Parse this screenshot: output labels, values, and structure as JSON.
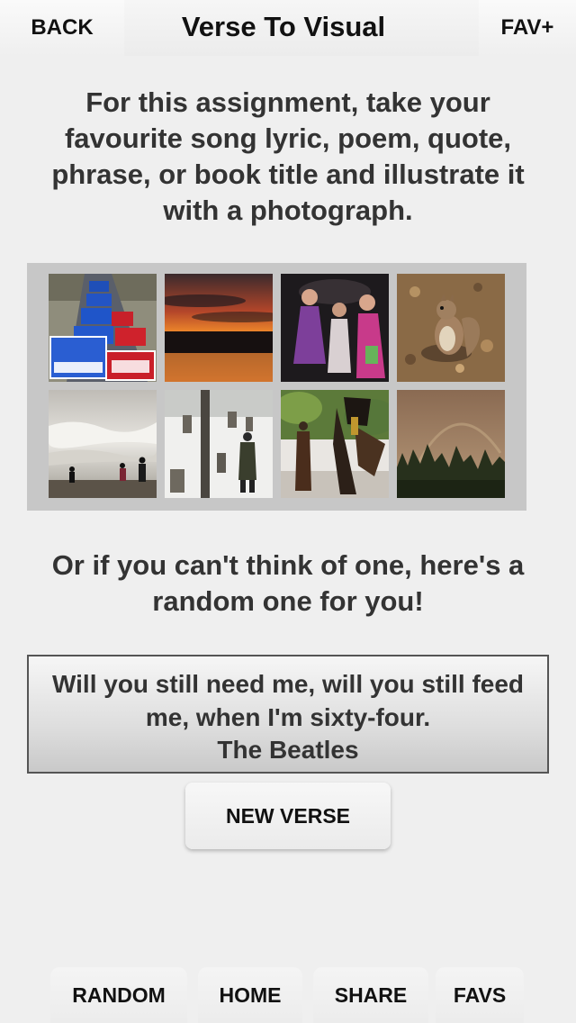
{
  "header": {
    "back_label": "BACK",
    "title": "Verse To Visual",
    "fav_label": "FAV+"
  },
  "intro": {
    "text": "For this assignment, take your favourite song lyric, poem, quote, phrase, or book title and illustrate it with a photograph."
  },
  "gallery": {
    "thumbnails": [
      {
        "subject": "campaign signs"
      },
      {
        "subject": "sunset over lake"
      },
      {
        "subject": "dancing crowd"
      },
      {
        "subject": "squirrel"
      },
      {
        "subject": "people on stormy beach"
      },
      {
        "subject": "snowy cemetery walker"
      },
      {
        "subject": "costumed dancer"
      },
      {
        "subject": "rainbow over forest"
      }
    ]
  },
  "random_prompt": {
    "text": "Or if you can't think of one, here's a random one for you!"
  },
  "verse": {
    "text": "Will you still need me, will you still feed me, when I'm sixty-four.",
    "author": "The Beatles"
  },
  "actions": {
    "new_verse_label": "NEW VERSE"
  },
  "bottom_nav": {
    "random_label": "RANDOM",
    "home_label": "HOME",
    "share_label": "SHARE",
    "favs_label": "FAVS"
  }
}
